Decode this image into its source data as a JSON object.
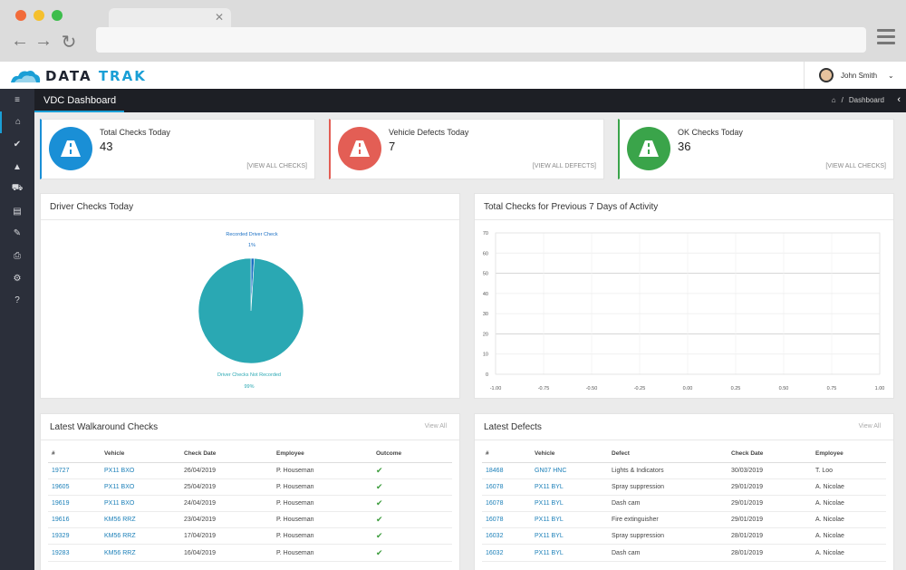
{
  "header": {
    "logo_a": "DATA",
    "logo_b": "TRAK",
    "user_name": "John Smith"
  },
  "sidebar": {
    "icons": [
      "menu-icon",
      "home-icon",
      "check-icon",
      "warning-icon",
      "truck-icon",
      "id-card-icon",
      "wrench-icon",
      "print-icon",
      "gears-icon",
      "help-icon"
    ],
    "glyphs": [
      "≡",
      "⌂",
      "✔",
      "▲",
      "⛟",
      "▤",
      "✎",
      "⎙",
      "⚙",
      "?"
    ]
  },
  "pagebar": {
    "title": "VDC Dashboard",
    "breadcrumb": "Dashboard",
    "separator": "/"
  },
  "stats": [
    {
      "label": "Total Checks Today",
      "value": "43",
      "link": "[VIEW ALL CHECKS]",
      "color": "#1a8fd6"
    },
    {
      "label": "Vehicle Defects Today",
      "value": "7",
      "link": "[VIEW ALL DEFECTS]",
      "color": "#e35e55"
    },
    {
      "label": "OK Checks Today",
      "value": "36",
      "link": "[VIEW ALL CHECKS]",
      "color": "#3aa44a"
    }
  ],
  "driver_checks": {
    "title": "Driver Checks Today"
  },
  "activity": {
    "title": "Total Checks for Previous 7 Days of Activity"
  },
  "chart_data": [
    {
      "type": "pie",
      "title": "Driver Checks Today",
      "labels": [
        "Recorded Driver Check",
        "Driver Checks Not Recorded"
      ],
      "values": [
        1,
        99
      ],
      "value_labels": [
        "1%",
        "99%"
      ],
      "colors": [
        "#1a6fc4",
        "#2aa8b3"
      ]
    },
    {
      "type": "line",
      "title": "Total Checks for Previous 7 Days of Activity",
      "x_ticks": [
        "-1.00",
        "-0.75",
        "-0.50",
        "-0.25",
        "0.00",
        "0.25",
        "0.50",
        "0.75",
        "1.00"
      ],
      "y_ticks": [
        "0",
        "10",
        "20",
        "30",
        "40",
        "50",
        "60",
        "70"
      ],
      "xlim": [
        -1,
        1
      ],
      "ylim": [
        0,
        70
      ],
      "series": []
    }
  ],
  "walkaround": {
    "title": "Latest Walkaround Checks",
    "view_all": "View All",
    "columns": [
      "#",
      "Vehicle",
      "Check Date",
      "Employee",
      "Outcome"
    ],
    "rows": [
      [
        "19727",
        "PX11 BXO",
        "26/04/2019",
        "P. Houseman",
        "✔"
      ],
      [
        "19605",
        "PX11 BXO",
        "25/04/2019",
        "P. Houseman",
        "✔"
      ],
      [
        "19619",
        "PX11 BXO",
        "24/04/2019",
        "P. Houseman",
        "✔"
      ],
      [
        "19616",
        "KM56 RRZ",
        "23/04/2019",
        "P. Houseman",
        "✔"
      ],
      [
        "19329",
        "KM56 RRZ",
        "17/04/2019",
        "P. Houseman",
        "✔"
      ],
      [
        "19283",
        "KM56 RRZ",
        "16/04/2019",
        "P. Houseman",
        "✔"
      ]
    ]
  },
  "defects": {
    "title": "Latest Defects",
    "view_all": "View All",
    "columns": [
      "#",
      "Vehicle",
      "Defect",
      "Check Date",
      "Employee"
    ],
    "rows": [
      [
        "18468",
        "GN07 HNC",
        "Lights & Indicators",
        "30/03/2019",
        "T. Loo"
      ],
      [
        "16078",
        "PX11 BYL",
        "Spray suppression",
        "29/01/2019",
        "A. Nicolae"
      ],
      [
        "16078",
        "PX11 BYL",
        "Dash cam",
        "29/01/2019",
        "A. Nicolae"
      ],
      [
        "16078",
        "PX11 BYL",
        "Fire extinguisher",
        "29/01/2019",
        "A. Nicolae"
      ],
      [
        "16032",
        "PX11 BYL",
        "Spray suppression",
        "28/01/2019",
        "A. Nicolae"
      ],
      [
        "16032",
        "PX11 BYL",
        "Dash cam",
        "28/01/2019",
        "A. Nicolae"
      ]
    ]
  }
}
